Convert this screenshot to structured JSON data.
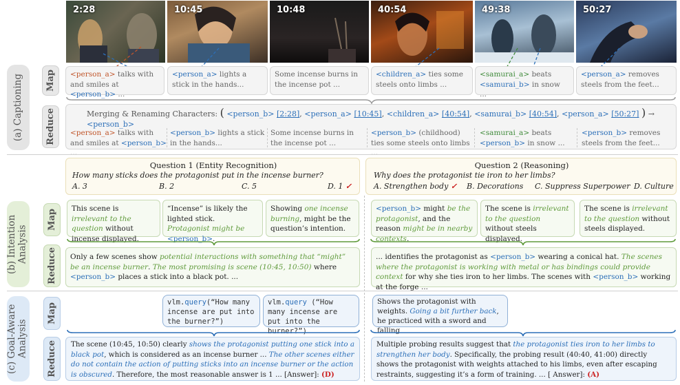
{
  "timestamps": [
    "2:28",
    "10:45",
    "10:48",
    "40:54",
    "49:38",
    "50:27"
  ],
  "side_labels": {
    "captioning": "(a) Captioning",
    "intention": "(b) Intention Analysis",
    "goal": "(c) Goal-Aware Analysis"
  },
  "tabs": {
    "map": "Map",
    "reduce": "Reduce"
  },
  "captions_map": [
    {
      "tag": "<person_a>",
      "rest": " talks with and smiles at ",
      "tag2": "<person_b>",
      "end": " ..."
    },
    {
      "tag": "<person_a>",
      "rest": " lights a stick in the hands..."
    },
    {
      "text": "Some incense burns in the incense pot ..."
    },
    {
      "tag": "<children_a>",
      "rest": " ties some steels onto limbs ..."
    },
    {
      "tag": "<samurai_a>",
      "rest": " beats ",
      "tag2": "<samurai_b>",
      "end": " in snow ..."
    },
    {
      "tag": "<person_a>",
      "rest": " removes steels from the feet..."
    }
  ],
  "merge": {
    "label": "Merging & Renaming Characters:",
    "items": [
      {
        "tag": "<person_b>",
        "time": "[2:28]"
      },
      {
        "tag": "<person_a>",
        "time": "[10:45]"
      },
      {
        "tag": "<children_a>",
        "time": "[40:54]"
      },
      {
        "tag": "<samurai_b>",
        "time": "[40:54]"
      },
      {
        "tag": "<person_a>",
        "time": "[50:27]"
      }
    ],
    "arrow": "→",
    "result": "<person_b>"
  },
  "captions_reduce": [
    {
      "tag": "<person_a>",
      "rest": " talks with and smiles at ",
      "tag2": "<person_b>",
      "end": " ..."
    },
    {
      "tag": "<person_b>",
      "rest": " lights a stick in the hands..."
    },
    {
      "text": "Some incense burns in the incense pot ..."
    },
    {
      "tag": "<person_b>",
      "rest": " (childhood) ties some steels onto limbs ..."
    },
    {
      "tag": "<samurai_a>",
      "rest": " beats ",
      "tag2": "<person_b>",
      "end": " in snow ..."
    },
    {
      "tag": "<person_b>",
      "rest": " removes steels from the feet..."
    }
  ],
  "q1": {
    "title": "Question 1 (Entity Recognition)",
    "question": "How many sticks does the protagonist put in the incense burner?",
    "options": [
      "A. 3",
      "B. 2",
      "C. 5",
      "D. 1"
    ],
    "check": "✓"
  },
  "q2": {
    "title": "Question 2 (Reasoning)",
    "question": "Why does the protagonist tie iron to her limbs?",
    "options": [
      "A. Strengthen body",
      "B. Decorations",
      "C. Suppress Superpower",
      "D. Culture"
    ],
    "check": "✓"
  },
  "intent_map_q1": [
    {
      "a": "This scene is ",
      "g": "irrelevant to the question",
      "b": " without incense displayed."
    },
    {
      "a": "“Incense” is likely the lighted stick. ",
      "g": "Protagonist might be ",
      "tag": "<person_b>",
      "b": "."
    },
    {
      "a": "Showing ",
      "g": "one incense burning",
      "b": ", might be the question’s intention."
    }
  ],
  "intent_map_q2": [
    {
      "tag": "<person_b>",
      "a": " might ",
      "g": "be the protagonist",
      "b": ", and the reason ",
      "g2": "might be in nearby contexts",
      "c": "."
    },
    {
      "a": "The scene is ",
      "g": "irrelevant to the question",
      "b": " without steels displayed."
    },
    {
      "a": "The scene is ",
      "g": "irrelevant to the question",
      "b": " without steels displayed."
    }
  ],
  "intent_reduce_q1": {
    "a": "Only a few scenes show ",
    "g": "potential interactions with something that “might” be an incense burner",
    "b": ". ",
    "g2": "The most promising is scene (10:45, 10:50)",
    "c": " where ",
    "tag": "<person_b>",
    "d": " places a stick into a black pot. ..."
  },
  "intent_reduce_q2": {
    "a": "... identifies the protagonist as ",
    "tag": "<person_b>",
    "b": " wearing a conical hat. ",
    "g": "The scenes where the protagonist is working with metal or has bindings could provide context",
    "c": " for why she ties iron to her limbs. The scenes with ",
    "tag2": "<person_b>",
    "d": " working at the forge ..."
  },
  "vlm_calls": [
    {
      "pre": "vlm.",
      "fn": "query",
      "arg": "(“How many incense are put into the burner?”)"
    },
    {
      "pre": "vlm.",
      "fn": "query",
      "arg": " (“How many incense are put into the burner?”)"
    }
  ],
  "goal_map_q2": {
    "a": "Shows the protagonist with weights. ",
    "b": "Going a bit further back",
    "c": ", he practiced with a sword and falling"
  },
  "goal_reduce_q1": {
    "a": "The scene (10:45, 10:50) clearly ",
    "b": "shows the protagonist putting one stick into a black pot",
    "c": ", which is considered as an incense burner ... ",
    "d": "The other scenes either do not contain the action of putting sticks into an incense burner or the action is obscured",
    "e": ". Therefore, the most reasonable answer is 1 ... [Answer]: ",
    "ans": "(D)"
  },
  "goal_reduce_q2": {
    "a": "Multiple probing results suggest that ",
    "b": "the protagonist ties iron to her limbs to strengthen her body",
    "c": ". Specifically, the probing result (40:40, 41:00) directly shows the protagonist with weights attached to his limbs, even after escaping restraints, suggesting it’s a form of training. ... [ Answer]: ",
    "ans": "(A)"
  },
  "colors": {
    "person_a": "#c0562b",
    "person_b": "#2c6fb8",
    "samurai": "#3f8a3a",
    "green_italic": "#5f9a3b",
    "answer_red": "#cc2222"
  }
}
